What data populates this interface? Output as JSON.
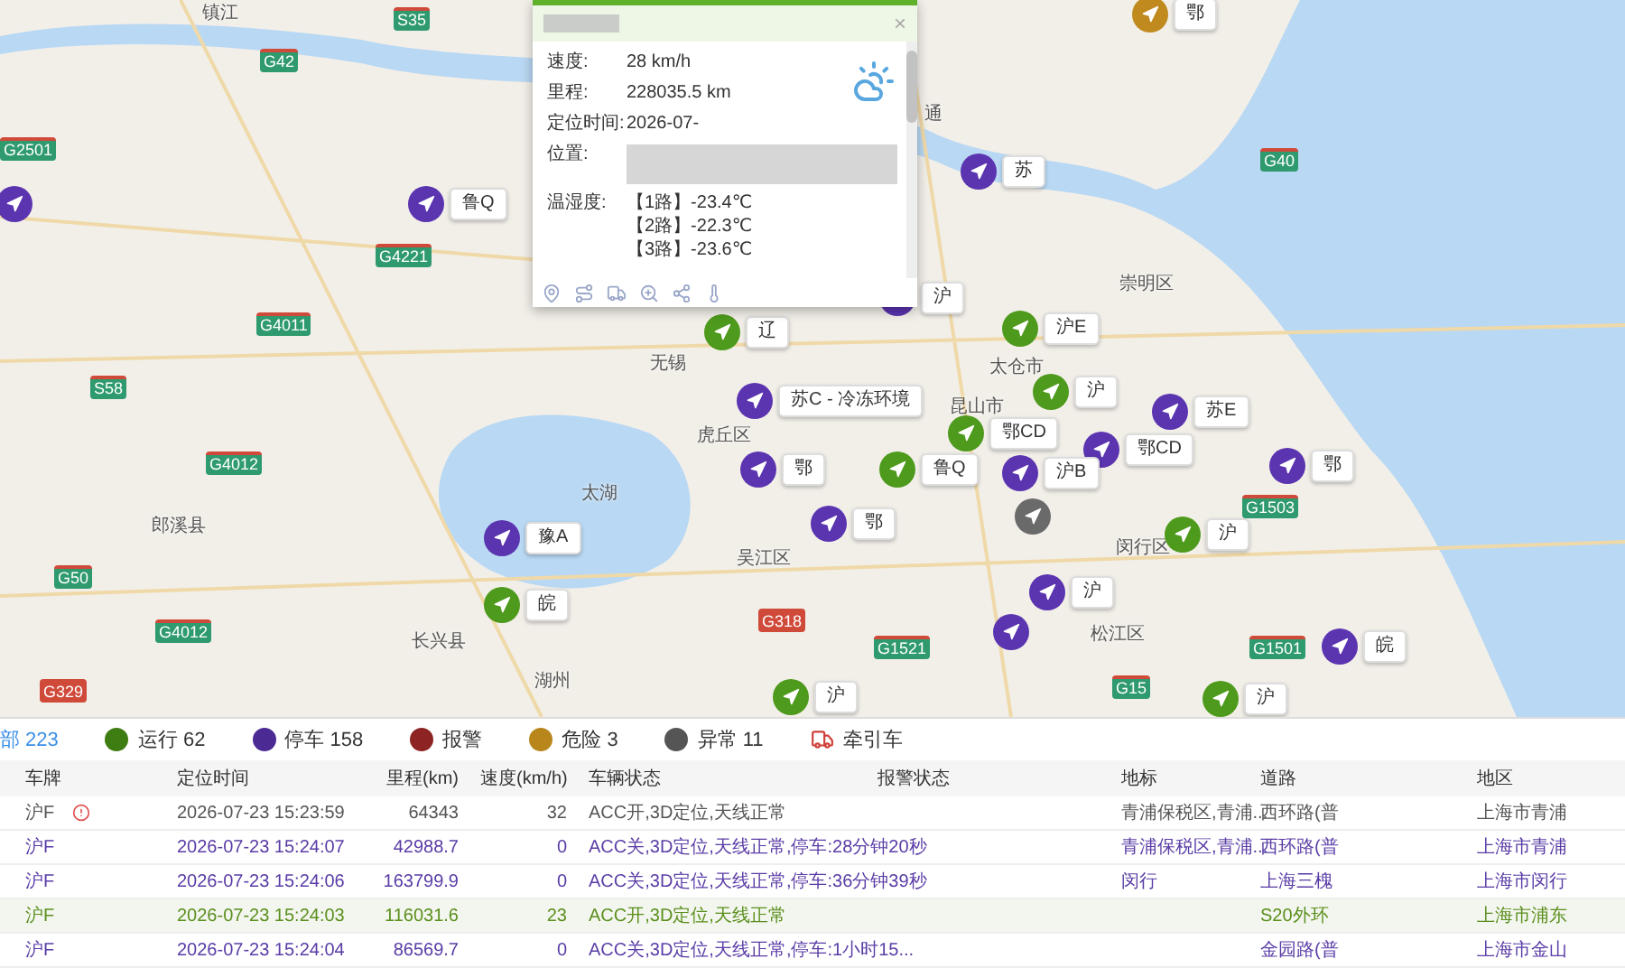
{
  "map": {
    "places": [
      {
        "name": "镇江"
      },
      {
        "name": "通"
      },
      {
        "name": "无锡"
      },
      {
        "name": "太湖"
      },
      {
        "name": "湖州"
      },
      {
        "name": "崇明区"
      },
      {
        "name": "太仓市"
      },
      {
        "name": "昆山市"
      },
      {
        "name": "虎丘区"
      },
      {
        "name": "吴江区"
      },
      {
        "name": "闵行区"
      },
      {
        "name": "松江区"
      },
      {
        "name": "长兴县"
      },
      {
        "name": "郎溪县"
      }
    ],
    "highways": [
      {
        "code": "S35",
        "color": "#2e9a6e"
      },
      {
        "code": "G42",
        "color": "#2e9a6e"
      },
      {
        "code": "G2501",
        "color": "#2e9a6e"
      },
      {
        "code": "G40",
        "color": "#2e9a6e"
      },
      {
        "code": "G4221",
        "color": "#2e9a6e"
      },
      {
        "code": "G4011",
        "color": "#2e9a6e"
      },
      {
        "code": "S58",
        "color": "#2e9a6e"
      },
      {
        "code": "G4012",
        "color": "#2e9a6e"
      },
      {
        "code": "G1503",
        "color": "#2e9a6e"
      },
      {
        "code": "G50",
        "color": "#2e9a6e"
      },
      {
        "code": "G318",
        "color": "#d04a3a"
      },
      {
        "code": "G4012",
        "color": "#2e9a6e"
      },
      {
        "code": "G1521",
        "color": "#2e9a6e"
      },
      {
        "code": "G1501",
        "color": "#2e9a6e"
      },
      {
        "code": "G15",
        "color": "#2e9a6e"
      },
      {
        "code": "G329",
        "color": "#d04a3a"
      }
    ],
    "vehicles": [
      {
        "label": "鄂",
        "kind": "danger"
      },
      {
        "kind": "stopped"
      },
      {
        "label": "鲁Q",
        "kind": "stopped"
      },
      {
        "label": "苏",
        "kind": "stopped"
      },
      {
        "label": "沪",
        "kind": "stopped"
      },
      {
        "label": "沪E",
        "kind": "running"
      },
      {
        "label": "辽",
        "kind": "running"
      },
      {
        "label": "苏C - 冷冻环境",
        "kind": "stopped"
      },
      {
        "label": "沪",
        "kind": "running"
      },
      {
        "label": "苏E",
        "kind": "stopped"
      },
      {
        "label": "鄂CD",
        "kind": "running"
      },
      {
        "label": "鄂CD",
        "kind": "stopped"
      },
      {
        "label": "鄂",
        "kind": "stopped"
      },
      {
        "label": "鲁Q",
        "kind": "running"
      },
      {
        "label": "沪B",
        "kind": "stopped"
      },
      {
        "label": "鄂",
        "kind": "stopped"
      },
      {
        "label": "鄂",
        "kind": "stopped"
      },
      {
        "label": "豫A",
        "kind": "stopped"
      },
      {
        "label": "皖",
        "kind": "running"
      },
      {
        "label": "沪",
        "kind": "running"
      },
      {
        "label": "沪",
        "kind": "stopped"
      },
      {
        "label": "皖",
        "kind": "stopped"
      },
      {
        "label": "沪",
        "kind": "running"
      },
      {
        "label": "沪",
        "kind": "running"
      },
      {
        "kind": "offline"
      },
      {
        "kind": "stopped"
      }
    ]
  },
  "popup": {
    "close": "×",
    "fields": [
      {
        "label": "速度:",
        "value": "28 km/h"
      },
      {
        "label": "里程:",
        "value": "228035.5 km"
      },
      {
        "label": "定位时间:",
        "value": "2026-07-"
      },
      {
        "label": "位置:"
      }
    ],
    "temperature": {
      "label": "温湿度:",
      "lines": [
        "【1路】-23.4℃",
        "【2路】-22.3℃",
        "【3路】-23.6℃"
      ]
    }
  },
  "legend": [
    {
      "kind": "tab",
      "label": "部 223",
      "selected": true
    },
    {
      "kind": "dot",
      "label": "运行 62",
      "color": "#3e7d12",
      "selected": false
    },
    {
      "kind": "dot",
      "label": "停车 158",
      "color": "#4b2a94",
      "selected": false
    },
    {
      "kind": "dot",
      "label": "报警",
      "color": "#8e2323",
      "selected": false
    },
    {
      "kind": "dot",
      "label": "危险 3",
      "color": "#b8861b",
      "selected": false
    },
    {
      "kind": "dot",
      "label": "异常 11",
      "color": "#555555",
      "selected": false
    },
    {
      "kind": "truck",
      "label": "牵引车",
      "selected": false
    }
  ],
  "table": {
    "columns": [
      "车牌",
      "定位时间",
      "里程(km)",
      "速度(km/h)",
      "车辆状态",
      "报警状态",
      "地标",
      "道路",
      "地区"
    ],
    "rows": [
      {
        "kind": "normal",
        "selected": false,
        "alert": true,
        "cells": [
          "沪F",
          "2026-07-23 15:23:59",
          "64343",
          "32",
          "ACC开,3D定位,天线正常",
          "",
          "青浦保税区,青浦...",
          "西环路(普",
          "上海市青浦"
        ]
      },
      {
        "kind": "stopped",
        "selected": false,
        "alert": false,
        "cells": [
          "沪F",
          "2026-07-23 15:24:07",
          "42988.7",
          "0",
          "ACC关,3D定位,天线正常,停车:28分钟20秒",
          "",
          "青浦保税区,青浦...",
          "西环路(普",
          "上海市青浦"
        ]
      },
      {
        "kind": "stopped",
        "selected": false,
        "alert": false,
        "cells": [
          "沪F",
          "2026-07-23 15:24:06",
          "163799.9",
          "0",
          "ACC关,3D定位,天线正常,停车:36分钟39秒",
          "",
          "闵行",
          "上海三槐",
          "上海市闵行"
        ]
      },
      {
        "kind": "running",
        "selected": true,
        "alert": false,
        "cells": [
          "沪F",
          "2026-07-23 15:24:03",
          "116031.6",
          "23",
          "ACC开,3D定位,天线正常",
          "",
          "",
          "S20外环",
          "上海市浦东"
        ]
      },
      {
        "kind": "stopped",
        "selected": false,
        "alert": false,
        "cells": [
          "沪F",
          "2026-07-23 15:24:04",
          "86569.7",
          "0",
          "ACC关,3D定位,天线正常,停车:1小时15...",
          "",
          "",
          "金园路(普",
          "上海市金山"
        ]
      }
    ]
  }
}
